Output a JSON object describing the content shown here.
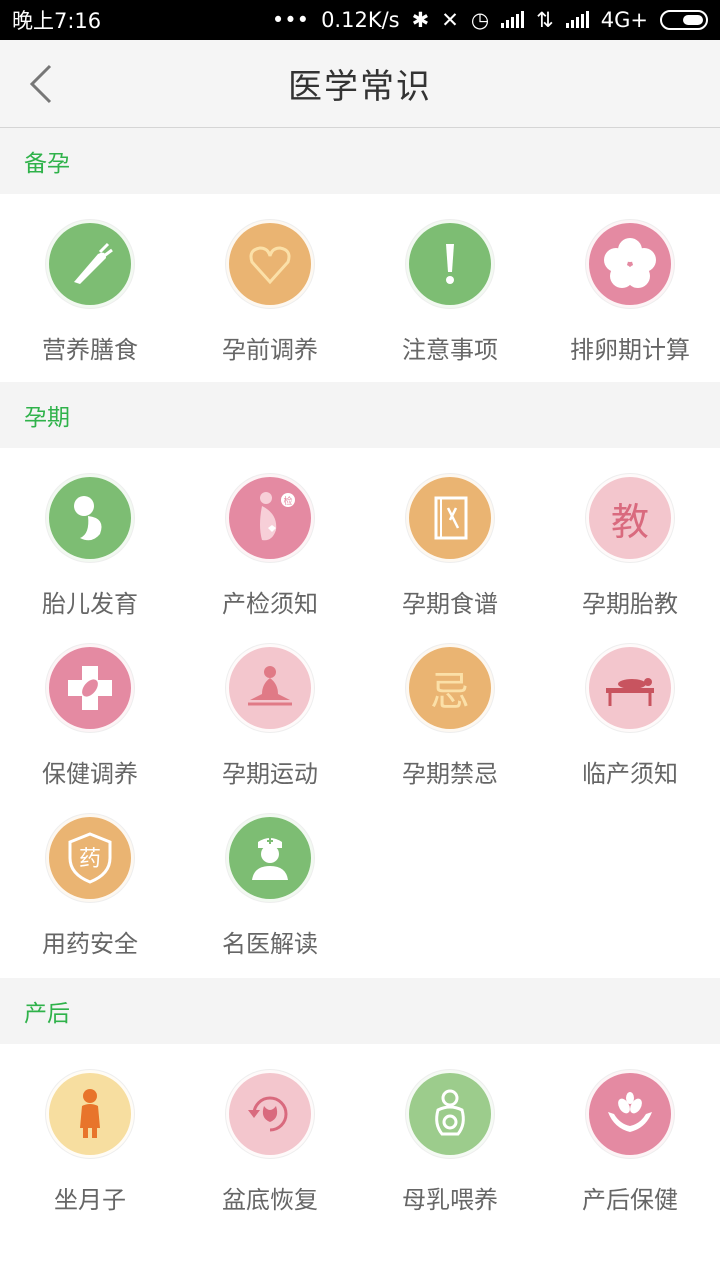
{
  "status": {
    "time": "晚上7:16",
    "dots": "•••",
    "speed": "0.12K/s",
    "network": "4G+"
  },
  "header": {
    "title": "医学常识"
  },
  "sections": [
    {
      "title": "备孕",
      "items": [
        {
          "label": "营养膳食",
          "icon": "carrot-icon",
          "color": "#7dbd73"
        },
        {
          "label": "孕前调养",
          "icon": "heart-icon",
          "color": "#eab472"
        },
        {
          "label": "注意事项",
          "icon": "exclamation-icon",
          "color": "#7dbd73"
        },
        {
          "label": "排卵期计算",
          "icon": "flower-icon",
          "color": "#e48aa2"
        }
      ]
    },
    {
      "title": "孕期",
      "items": [
        {
          "label": "胎儿发育",
          "icon": "fetus-icon",
          "color": "#7dbd73"
        },
        {
          "label": "产检须知",
          "icon": "pregnant-woman-icon",
          "color": "#e48aa2",
          "badge": "检"
        },
        {
          "label": "孕期食谱",
          "icon": "recipe-book-icon",
          "color": "#eab472"
        },
        {
          "label": "孕期胎教",
          "icon": "education-icon",
          "color": "#f3c6cd",
          "glyph": "教"
        },
        {
          "label": "保健调养",
          "icon": "medical-cross-icon",
          "color": "#e48aa2"
        },
        {
          "label": "孕期运动",
          "icon": "yoga-icon",
          "color": "#f3c6cd"
        },
        {
          "label": "孕期禁忌",
          "icon": "taboo-icon",
          "color": "#eab472",
          "glyph": "忌"
        },
        {
          "label": "临产须知",
          "icon": "delivery-bed-icon",
          "color": "#f3c6cd"
        },
        {
          "label": "用药安全",
          "icon": "medicine-shield-icon",
          "color": "#eab472",
          "glyph": "药"
        },
        {
          "label": "名医解读",
          "icon": "doctor-icon",
          "color": "#7dbd73"
        }
      ]
    },
    {
      "title": "产后",
      "items": [
        {
          "label": "坐月子",
          "icon": "mother-icon",
          "color": "#f7dea0"
        },
        {
          "label": "盆底恢复",
          "icon": "pelvic-recovery-icon",
          "color": "#f3c6cd"
        },
        {
          "label": "母乳喂养",
          "icon": "breastfeeding-icon",
          "color": "#9ccc8c"
        },
        {
          "label": "产后保健",
          "icon": "care-hands-icon",
          "color": "#e48aa2"
        }
      ]
    }
  ]
}
